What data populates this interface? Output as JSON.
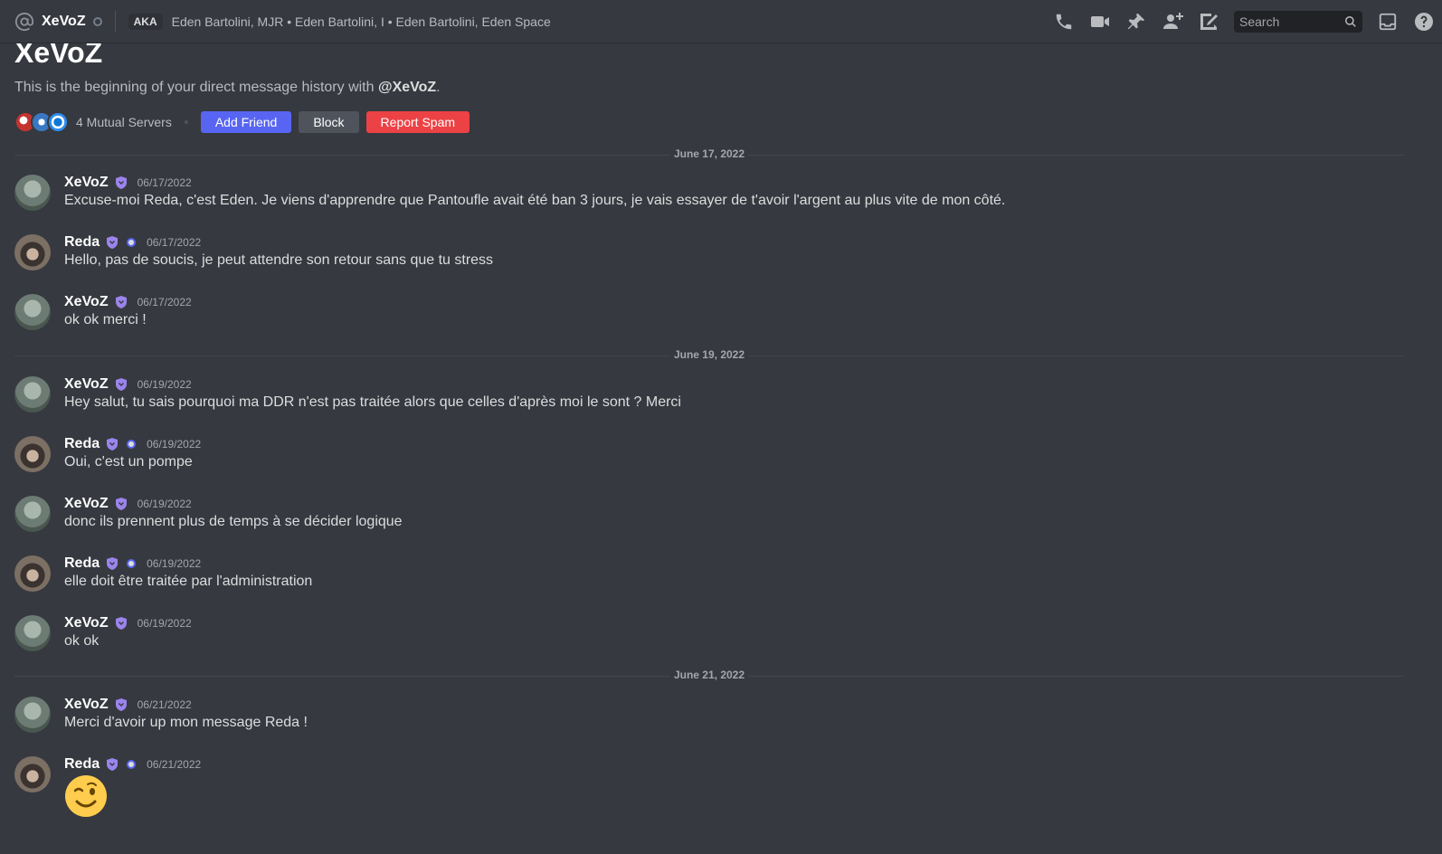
{
  "topbar": {
    "dm_name": "XeVoZ",
    "aka_label": "AKA",
    "aka_names": "Eden Bartolini, MJR • Eden Bartolini, I • Eden Bartolini, Eden Space",
    "search_placeholder": "Search"
  },
  "header": {
    "title": "XeVoZ",
    "subtitle_prefix": "This is the beginning of your direct message history with ",
    "subtitle_handle": "@XeVoZ",
    "subtitle_suffix": ".",
    "mutual_servers": "4 Mutual Servers",
    "add_friend": "Add Friend",
    "block": "Block",
    "report_spam": "Report Spam"
  },
  "dividers": [
    "June 17, 2022",
    "June 19, 2022",
    "June 21, 2022"
  ],
  "messages": [
    {
      "author": "XeVoZ",
      "time": "06/17/2022",
      "text": "Excuse-moi Reda, c'est Eden. Je viens d'apprendre que Pantoufle avait été ban 3 jours, je vais essayer de t'avoir l'argent au plus vite de mon côté."
    },
    {
      "author": "Reda",
      "time": "06/17/2022",
      "text": "Hello, pas de soucis, je peut attendre son retour sans que tu stress"
    },
    {
      "author": "XeVoZ",
      "time": "06/17/2022",
      "text": "ok ok merci !"
    },
    {
      "author": "XeVoZ",
      "time": "06/19/2022",
      "text": "Hey salut, tu sais pourquoi ma DDR n'est pas traitée alors que celles d'après moi le sont ? Merci"
    },
    {
      "author": "Reda",
      "time": "06/19/2022",
      "text": "Oui, c'est un pompe"
    },
    {
      "author": "XeVoZ",
      "time": "06/19/2022",
      "text": "donc ils prennent plus de temps à se décider logique"
    },
    {
      "author": "Reda",
      "time": "06/19/2022",
      "text": "elle doit être traitée par l'administration"
    },
    {
      "author": "XeVoZ",
      "time": "06/19/2022",
      "text": "ok ok"
    },
    {
      "author": "XeVoZ",
      "time": "06/21/2022",
      "text": "Merci d'avoir up mon message Reda !"
    },
    {
      "author": "Reda",
      "time": "06/21/2022",
      "emoji": "winking-face"
    }
  ],
  "colors": {
    "background": "#36393f",
    "blurple": "#5865f2",
    "danger": "#ed4245",
    "secondary": "#4f545c",
    "badge_purple": "#9b84ec"
  }
}
